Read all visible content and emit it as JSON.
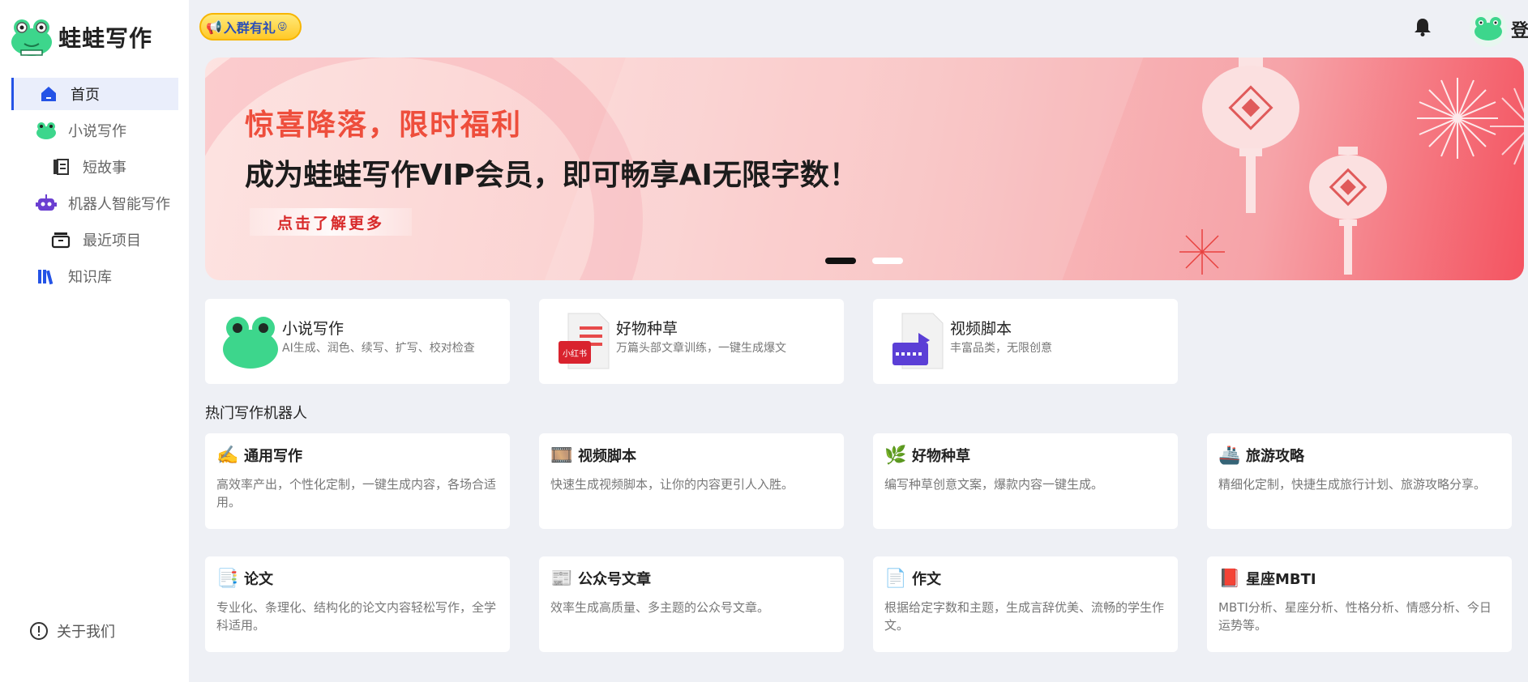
{
  "app": {
    "name": "蛙蛙写作"
  },
  "sidebar": {
    "items": [
      {
        "label": "首页",
        "icon": "home-icon"
      },
      {
        "label": "小说写作",
        "icon": "frog-icon"
      },
      {
        "label": "短故事",
        "icon": "document-icon"
      },
      {
        "label": "机器人智能写作",
        "icon": "robot-icon"
      },
      {
        "label": "最近项目",
        "icon": "folder-icon"
      },
      {
        "label": "知识库",
        "icon": "books-icon"
      }
    ],
    "about": "关于我们"
  },
  "header": {
    "group_badge": "入群有礼",
    "login": "登"
  },
  "banner": {
    "subtitle": "惊喜降落，限时福利",
    "title": "成为蛙蛙写作VIP会员，即可畅享AI无限字数！",
    "cta": "点击了解更多",
    "slides": 2,
    "active_slide": 1
  },
  "features": [
    {
      "title": "小说写作",
      "desc": "AI生成、润色、续写、扩写、校对检查",
      "icon": "frog-icon"
    },
    {
      "title": "好物种草",
      "desc": "万篇头部文章训练，一键生成爆文",
      "icon": "xiaohongshu-doc-icon",
      "badge": "小红书"
    },
    {
      "title": "视频脚本",
      "desc": "丰富品类，无限创意",
      "icon": "video-doc-icon"
    }
  ],
  "section_title": "热门写作机器人",
  "bots": [
    {
      "title": "通用写作",
      "desc": "高效率产出，个性化定制，一键生成内容，各场合适用。",
      "icon": "✍️"
    },
    {
      "title": "视频脚本",
      "desc": "快速生成视频脚本，让你的内容更引人入胜。",
      "icon": "🎞️"
    },
    {
      "title": "好物种草",
      "desc": "编写种草创意文案，爆款内容一键生成。",
      "icon": "🌿"
    },
    {
      "title": "旅游攻略",
      "desc": "精细化定制，快捷生成旅行计划、旅游攻略分享。",
      "icon": "🚢"
    },
    {
      "title": "论文",
      "desc": "专业化、条理化、结构化的论文内容轻松写作，全学科适用。",
      "icon": "📑"
    },
    {
      "title": "公众号文章",
      "desc": "效率生成高质量、多主题的公众号文章。",
      "icon": "📰"
    },
    {
      "title": "作文",
      "desc": "根据给定字数和主题，生成言辞优美、流畅的学生作文。",
      "icon": "📄"
    },
    {
      "title": "星座MBTI",
      "desc": "MBTI分析、星座分析、性格分析、情感分析、今日运势等。",
      "icon": "📕"
    }
  ],
  "colors": {
    "accent": "#2453e6",
    "brand_green": "#3dd68c",
    "banner_red": "#ee4e3c"
  }
}
